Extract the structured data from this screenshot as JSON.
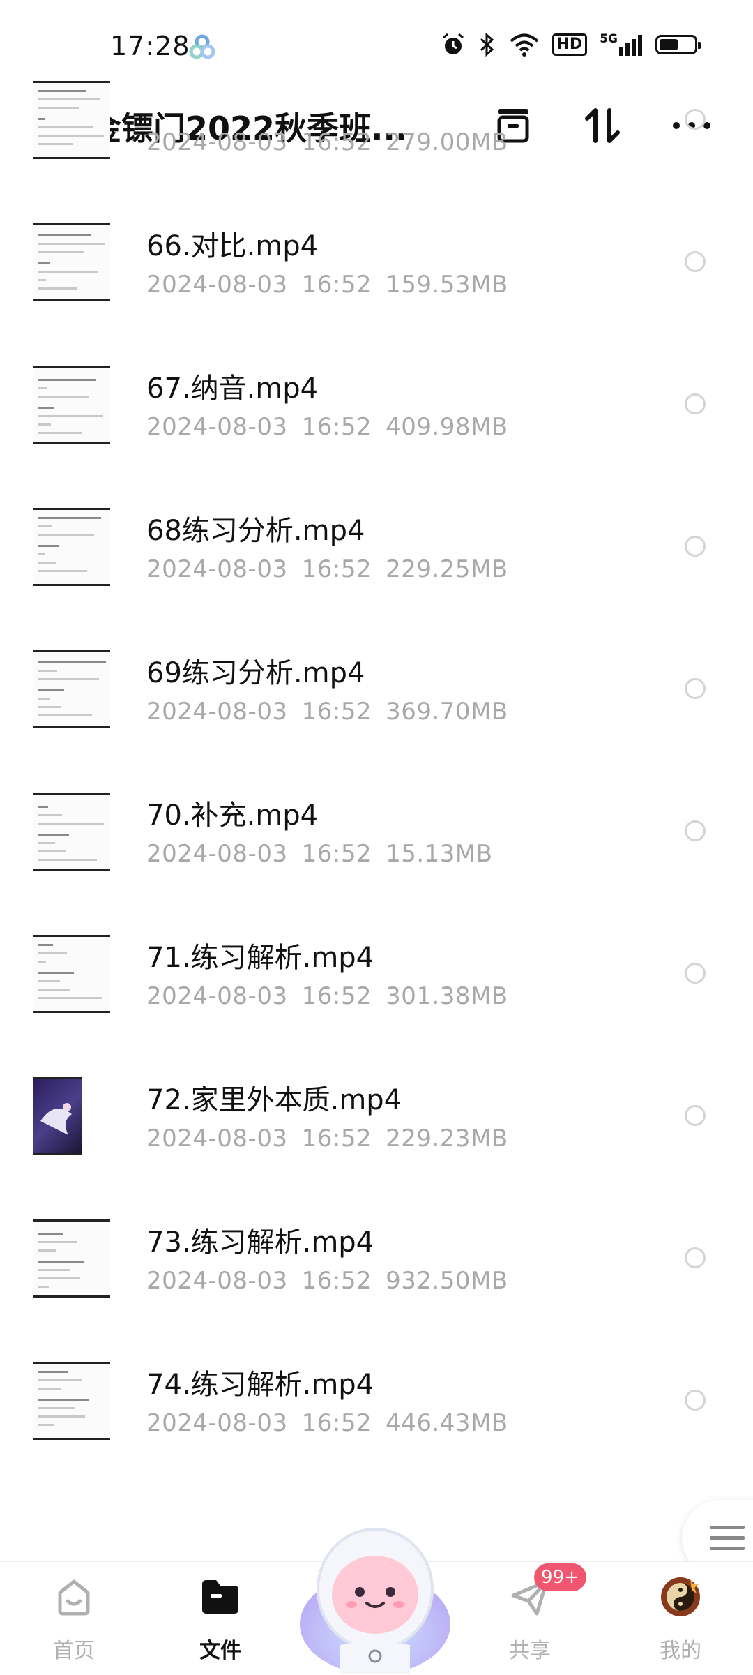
{
  "status_bar": {
    "time": "17:28",
    "network": "5G",
    "hd": "HD",
    "battery_level": 0.55,
    "icons": [
      "app-icon",
      "alarm-icon",
      "bluetooth-icon",
      "wifi-icon",
      "hd-icon",
      "signal-icon",
      "battery-icon"
    ]
  },
  "header": {
    "title": "金镖门2022秋季班...",
    "icons": [
      "back-icon",
      "archive-icon",
      "sort-icon",
      "more-icon"
    ]
  },
  "files": [
    {
      "name": "",
      "date": "2024-08-03",
      "time": "16:52",
      "size": "279.00MB",
      "thumb": "doc"
    },
    {
      "name": "66.对比.mp4",
      "date": "2024-08-03",
      "time": "16:52",
      "size": "159.53MB",
      "thumb": "doc"
    },
    {
      "name": "67.纳音.mp4",
      "date": "2024-08-03",
      "time": "16:52",
      "size": "409.98MB",
      "thumb": "doc"
    },
    {
      "name": "68练习分析.mp4",
      "date": "2024-08-03",
      "time": "16:52",
      "size": "229.25MB",
      "thumb": "doc"
    },
    {
      "name": "69练习分析.mp4",
      "date": "2024-08-03",
      "time": "16:52",
      "size": "369.70MB",
      "thumb": "doc"
    },
    {
      "name": "70.补充.mp4",
      "date": "2024-08-03",
      "time": "16:52",
      "size": "15.13MB",
      "thumb": "doc"
    },
    {
      "name": "71.练习解析.mp4",
      "date": "2024-08-03",
      "time": "16:52",
      "size": "301.38MB",
      "thumb": "doc"
    },
    {
      "name": "72.家里外本质.mp4",
      "date": "2024-08-03",
      "time": "16:52",
      "size": "229.23MB",
      "thumb": "image"
    },
    {
      "name": "73.练习解析.mp4",
      "date": "2024-08-03",
      "time": "16:52",
      "size": "932.50MB",
      "thumb": "doc"
    },
    {
      "name": "74.练习解析.mp4",
      "date": "2024-08-03",
      "time": "16:52",
      "size": "446.43MB",
      "thumb": "doc"
    }
  ],
  "bottom_nav": {
    "items": [
      {
        "label": "首页",
        "icon": "home-icon",
        "active": false
      },
      {
        "label": "文件",
        "icon": "folder-icon",
        "active": true
      },
      {
        "label": "共享",
        "icon": "share-icon",
        "active": false,
        "badge": "99+"
      },
      {
        "label": "我的",
        "icon": "avatar-icon",
        "active": false
      }
    ]
  },
  "colors": {
    "badge": "#f0566f",
    "meta_text": "#a8a8a8",
    "nav_inactive": "#b0b0b0"
  }
}
